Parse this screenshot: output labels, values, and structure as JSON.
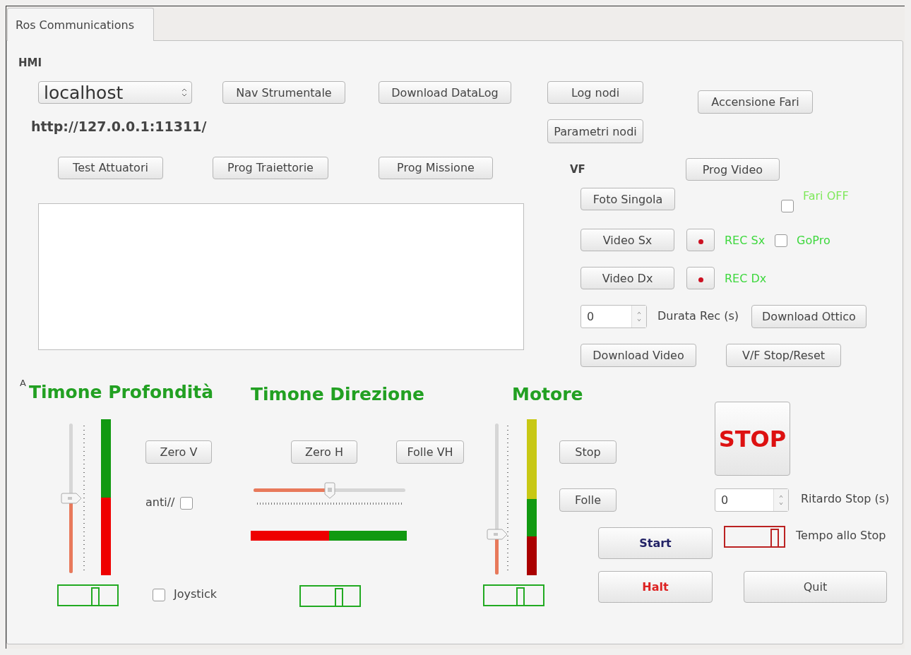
{
  "tabs": [
    {
      "label": "Ros Communications",
      "selected": true
    }
  ],
  "hmi": {
    "label": "HMI",
    "host_select": {
      "value": "localhost"
    },
    "url": "http://127.0.0.1:11311/",
    "nav_button": "Nav Strumentale",
    "datalog_button": "Download DataLog",
    "log_button": "Log nodi",
    "lights_button": "Accensione Fari",
    "params_button": "Parametri nodi",
    "row_buttons": [
      "Test Attuatori",
      "Prog Traiettorie",
      "Prog Missione"
    ]
  },
  "vf": {
    "label": "VF",
    "prog_video": "Prog Video",
    "photo_button": "Foto Singola",
    "lights_off": {
      "label": "Fari OFF",
      "checked": false
    },
    "video_rows": [
      {
        "button": "Video Sx",
        "rec_label": "REC Sx"
      },
      {
        "button": "Video Dx",
        "rec_label": "REC Dx"
      }
    ],
    "gopro": {
      "label": "GoPro",
      "checked": false
    },
    "duration": {
      "value": "0",
      "label": "Durata Rec (s)"
    },
    "optic_button": "Download Ottico",
    "video_button": "Download Video",
    "reset_button": "V/F Stop/Reset"
  },
  "depth": {
    "corner_label": "A",
    "title": "Timone Profondità",
    "slider": {
      "level": 0.5
    },
    "meter": {
      "level": 0.5
    },
    "zero_button": "Zero V",
    "anti": {
      "label": "anti//",
      "checked": false
    },
    "indicator": {
      "level": 0.65
    },
    "joystick": {
      "label": "Joystick",
      "checked": false
    }
  },
  "direction": {
    "title": "Timone Direzione",
    "zero_button": "Zero H",
    "neutral_button": "Folle VH",
    "slider": {
      "level": 0.5
    },
    "meter": {
      "level": 0.5
    },
    "indicator": {
      "level": 0.67
    }
  },
  "motor": {
    "title": "Motore",
    "slider": {
      "level": 0.25
    },
    "meter": {
      "level": 0.25
    },
    "stop_button": "Stop",
    "neutral_button": "Folle",
    "indicator": {
      "level": 0.64
    }
  },
  "controls": {
    "stop_big": "STOP",
    "delay": {
      "value": "0",
      "label": "Ritardo Stop (s)"
    },
    "start": "Start",
    "time_to_stop": {
      "label": "Tempo allo Stop",
      "level": 0.87
    },
    "halt": "Halt",
    "quit": "Quit"
  }
}
